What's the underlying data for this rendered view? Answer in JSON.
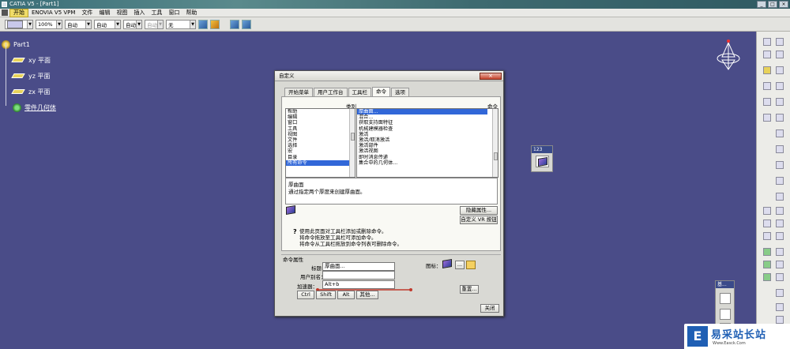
{
  "window": {
    "title": "CATIA V5 - [Part1]"
  },
  "menu": [
    "开始",
    "ENOVIA V5 VPM",
    "文件",
    "编辑",
    "视图",
    "插入",
    "工具",
    "窗口",
    "帮助"
  ],
  "toolbar": {
    "zoom": "100%",
    "combo1": "自动",
    "combo2": "自动",
    "combo3": "自动",
    "combo4": "自动",
    "combo5": "无"
  },
  "tree": {
    "root": "Part1",
    "items": [
      "xy 平面",
      "yz 平面",
      "zx 平面",
      "零件几何体"
    ]
  },
  "floating": {
    "toolbar1_title": "123",
    "toolbar2_title": "基..."
  },
  "dialog": {
    "title": "自定义",
    "tabs": [
      "开始菜单",
      "用户工作台",
      "工具栏",
      "命令",
      "选项"
    ],
    "category_label": "类别",
    "command_label": "命令",
    "categories": [
      "帮助",
      "编辑",
      "窗口",
      "工具",
      "视图",
      "文件",
      "选择",
      "宏",
      "目录",
      "所有命令"
    ],
    "selected_category": "所有命令",
    "commands": [
      "厚曲面...",
      "混合...",
      "获取支持面特征",
      "机械建模器检查",
      "激活",
      "激活/取消激活",
      "激活部件",
      "激活视图",
      "即时消息传递",
      "集合中的几何体..."
    ],
    "selected_command": "厚曲面...",
    "desc_name": "厚曲面",
    "desc_text": "通过指定两个厚度来创建厚曲面。",
    "btn_show_props": "隐藏属性...",
    "btn_customize_vr": "自定义 VR 按钮",
    "info": [
      "使用此页面对工具栏添加或删除命令。",
      "将命令拖放至工具栏可添加命令。",
      "将命令从工具栏拖放到命令列表可删除命令。"
    ],
    "props_header": "命令属性",
    "label_title": "标题：",
    "value_title": "厚曲面...",
    "label_alias": "用户别名：",
    "value_alias": "",
    "label_accel": "加速器：",
    "value_accel": "Alt+b",
    "label_icon": "图标：",
    "btn_icon_more": "...",
    "btn_ctrl": "Ctrl",
    "btn_shift": "Shift",
    "btn_alt": "Alt",
    "btn_other": "其他...",
    "btn_reset": "重置...",
    "btn_close": "关闭"
  },
  "watermark": {
    "logo": "E",
    "text": "易采站长站",
    "url": "Www.Easck.Com"
  },
  "colors": {
    "background": "#4a4c88",
    "selection": "#3167d8",
    "annotation": "#c0392b"
  }
}
